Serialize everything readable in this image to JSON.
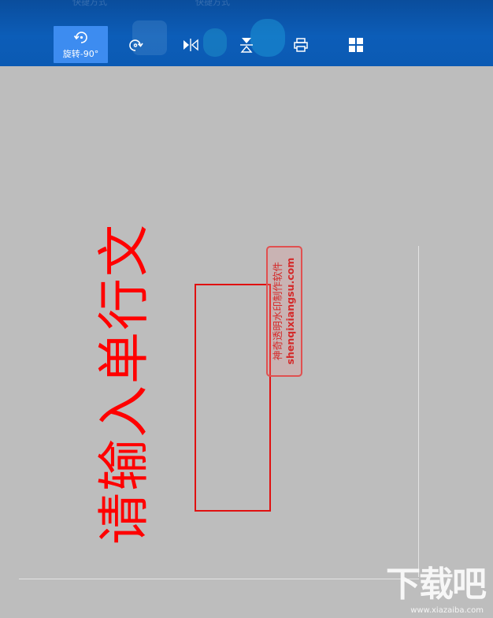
{
  "toolbar": {
    "ghost_shortcut_left": "快捷方式",
    "ghost_shortcut_right": "快捷方式",
    "rotate_label": "旋转-90°",
    "buttons": [
      {
        "icon": "rotate-ccw-icon",
        "active": true
      },
      {
        "icon": "rotate-cw-icon",
        "active": false
      },
      {
        "icon": "flip-horizontal-icon",
        "active": false
      },
      {
        "icon": "flip-vertical-icon",
        "active": false
      },
      {
        "icon": "print-icon",
        "active": false
      },
      {
        "icon": "grid-icon",
        "active": false
      }
    ],
    "accent_color": "#3d8cf0",
    "bar_color": "#0c5db8"
  },
  "canvas": {
    "vertical_text": "请输入单行文",
    "text_color": "#ff0000",
    "watermark": {
      "line1": "神奇透明水印制作软件",
      "line2": "shenqixiangsu.com"
    }
  },
  "site_logo": {
    "text": "下载吧",
    "url": "www.xiazaiba.com"
  }
}
